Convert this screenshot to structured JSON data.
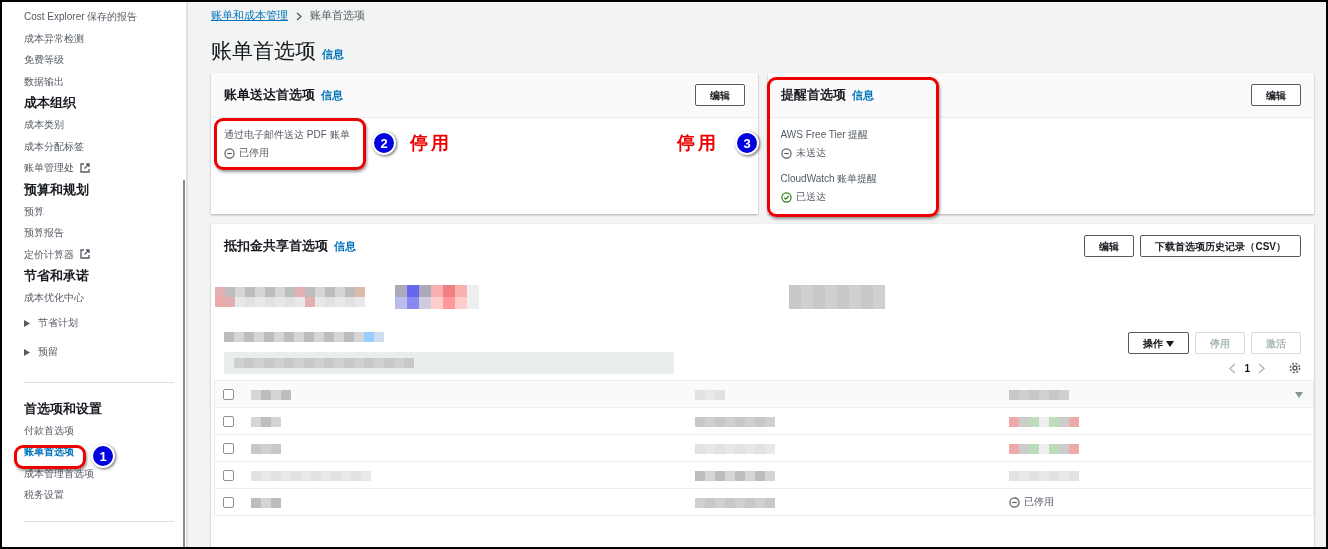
{
  "sidebar": {
    "groups": [
      {
        "divider_after": false,
        "items": [
          {
            "label": "Cost Explorer 保存的报告",
            "kind": "link",
            "selected": false
          },
          {
            "label": "成本异常检测",
            "kind": "link",
            "selected": false
          },
          {
            "label": "免费等级",
            "kind": "link",
            "selected": false
          },
          {
            "label": "数据输出",
            "kind": "link",
            "selected": false
          }
        ]
      },
      {
        "heading": "成本组织",
        "divider_after": false,
        "items": [
          {
            "label": "成本类别",
            "kind": "link",
            "selected": false
          },
          {
            "label": "成本分配标签",
            "kind": "link",
            "selected": false
          },
          {
            "label": "账单管理处",
            "kind": "external",
            "selected": false
          }
        ]
      },
      {
        "heading": "预算和规划",
        "divider_after": false,
        "items": [
          {
            "label": "预算",
            "kind": "link",
            "selected": false
          },
          {
            "label": "预算报告",
            "kind": "link",
            "selected": false
          },
          {
            "label": "定价计算器",
            "kind": "external",
            "selected": false
          }
        ]
      },
      {
        "heading": "节省和承诺",
        "divider_after": true,
        "items": [
          {
            "label": "成本优化中心",
            "kind": "link",
            "selected": false
          },
          {
            "label": "节省计划",
            "kind": "expandable",
            "expanded": false,
            "selected": false
          },
          {
            "label": "预留",
            "kind": "expandable",
            "expanded": false,
            "selected": false
          }
        ]
      },
      {
        "heading": "首选项和设置",
        "divider_after": true,
        "items": [
          {
            "label": "付款首选项",
            "kind": "link",
            "selected": false
          },
          {
            "label": "账单首选项",
            "kind": "link",
            "selected": true
          },
          {
            "label": "成本管理首选项",
            "kind": "link",
            "selected": false
          },
          {
            "label": "税务设置",
            "kind": "link",
            "selected": false
          }
        ]
      }
    ]
  },
  "breadcrumb": [
    {
      "label": "账单和成本管理",
      "kind": "link"
    },
    {
      "label": "账单首选项",
      "kind": "current"
    }
  ],
  "page_title": "账单首选项",
  "page_info": "信息",
  "delivery_card": {
    "title": "账单送达首选项",
    "info": "信息",
    "edit_button": "编辑",
    "fields": [
      {
        "label": "通过电子邮件送达 PDF 账单",
        "status": "已停用",
        "status_ok": false
      }
    ]
  },
  "alert_card": {
    "title": "提醒首选项",
    "info": "信息",
    "edit_button": "编辑",
    "fields": [
      {
        "label": "AWS Free Tier 提醒",
        "status": "未送达",
        "status_ok": false
      },
      {
        "label": "CloudWatch 账单提醒",
        "status": "已送达",
        "status_ok": true
      }
    ]
  },
  "credit_card": {
    "title": "抵扣金共享首选项",
    "info": "信息",
    "buttons": [
      "编辑",
      "下载首选项历史记录（CSV）"
    ],
    "all_selected": false,
    "actions_menu": "操作",
    "table_buttons": [
      {
        "label": "停用",
        "disabled": true
      },
      {
        "label": "激活",
        "disabled": true
      }
    ],
    "page": "1",
    "rows": [
      {
        "selected": false
      },
      {
        "selected": false
      },
      {
        "selected": false
      },
      {
        "selected": false,
        "status": "已停用",
        "status_ok": false
      }
    ]
  },
  "annotations": {
    "badges": [
      "1",
      "2",
      "3"
    ],
    "notes": [
      "停用",
      "停用"
    ]
  }
}
